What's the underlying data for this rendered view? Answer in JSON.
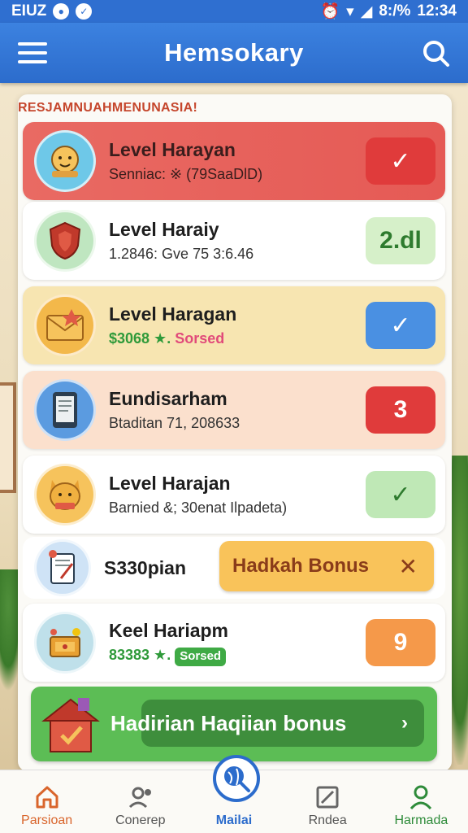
{
  "status_bar": {
    "carrier": "EIUZ",
    "battery": "8:/%",
    "time": "12:34"
  },
  "app_bar": {
    "title": "Hemsokary"
  },
  "section_header": "RESJAMNUAHMENUNASIA!",
  "rows": [
    {
      "title": "Level Harayan",
      "subtitle": "Senniac: ※ (79SaaDlD)",
      "action": "✓",
      "action_color": "#e03b3b"
    },
    {
      "title": "Level Haraiy",
      "subtitle": "1.2846: Gve 75 3:6.46",
      "action": "2.dl",
      "action_color": "#d6f0c9"
    },
    {
      "title": "Level Haragan",
      "subtitle_green": "$3068 ★.",
      "subtitle_pink": "Sorsed",
      "action": "✓",
      "action_color": "#4a90e2"
    },
    {
      "title": "Eundisarham",
      "subtitle": "Btaditan 71, 208633",
      "action": "3",
      "action_color": "#e03b3b"
    },
    {
      "title": "Level Harajan",
      "subtitle": "Barnied &; 30enat Ilpadeta)",
      "action": "✓",
      "action_color": "#bfe8b6"
    },
    {
      "title": "S330pian"
    },
    {
      "title": "Keel Hariapm",
      "subtitle_green": "83383 ★.",
      "badge": "Sorsed",
      "action": "9",
      "action_color": "#f5994a"
    }
  ],
  "bonus_pill": {
    "label": "Hadkah Bonus",
    "close": "✕"
  },
  "bonus_banner": {
    "label": "Hadirian Haqiian bonus",
    "chevron": "›"
  },
  "bottom_nav": [
    {
      "label": "Parsioan",
      "icon": "home-icon",
      "color": "#d9652c"
    },
    {
      "label": "Conerep",
      "icon": "profile-gear-icon",
      "color": "#666666"
    },
    {
      "label": "Mailai",
      "icon": "globe-search-icon",
      "color": "#2c6ccc"
    },
    {
      "label": "Rndea",
      "icon": "edit-note-icon",
      "color": "#666666"
    },
    {
      "label": "Harmada",
      "icon": "user-icon",
      "color": "#2e8b3a"
    }
  ]
}
